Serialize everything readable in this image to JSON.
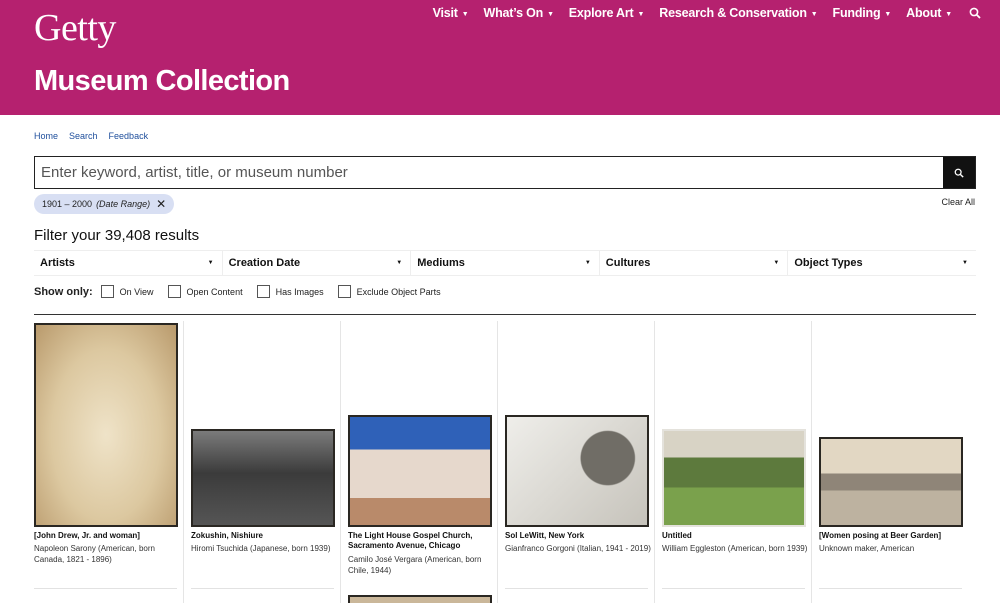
{
  "header": {
    "logo": "Getty",
    "page_title": "Museum Collection",
    "nav": [
      {
        "label": "Visit"
      },
      {
        "label": "What’s On"
      },
      {
        "label": "Explore Art"
      },
      {
        "label": "Research & Conservation"
      },
      {
        "label": "Funding"
      },
      {
        "label": "About"
      }
    ],
    "search_icon": "search-icon",
    "accent_color": "#b5216f"
  },
  "breadcrumb": [
    "Home",
    "Search",
    "Feedback"
  ],
  "search": {
    "placeholder": "Enter keyword, artist, title, or museum number",
    "value": ""
  },
  "active_filter": {
    "value": "1901 – 2000",
    "type": "(Date Range)"
  },
  "clear_all": "Clear All",
  "results_title": "Filter your 39,408 results",
  "filters": [
    "Artists",
    "Creation Date",
    "Mediums",
    "Cultures",
    "Object Types"
  ],
  "show_only": {
    "label": "Show only:",
    "options": [
      "On View",
      "Open Content",
      "Has Images",
      "Exclude Object Parts"
    ]
  },
  "results": [
    {
      "title": "[John Drew, Jr. and woman]",
      "meta": "Napoleon Sarony (American, born Canada, 1821 - 1896)"
    },
    {
      "title": "Zokushin, Nishiure",
      "meta": "Hiromi Tsuchida (Japanese, born 1939)"
    },
    {
      "title": "The Light House Gospel Church, Sacramento Avenue, Chicago",
      "meta": "Camilo José Vergara (American, born Chile, 1944)"
    },
    {
      "title": "Sol LeWitt, New York",
      "meta": "Gianfranco Gorgoni (Italian, 1941 - 2019)"
    },
    {
      "title": "Untitled",
      "meta": "William Eggleston (American, born 1939)"
    },
    {
      "title": "[Women posing at Beer Garden]",
      "meta": "Unknown maker, American"
    }
  ]
}
